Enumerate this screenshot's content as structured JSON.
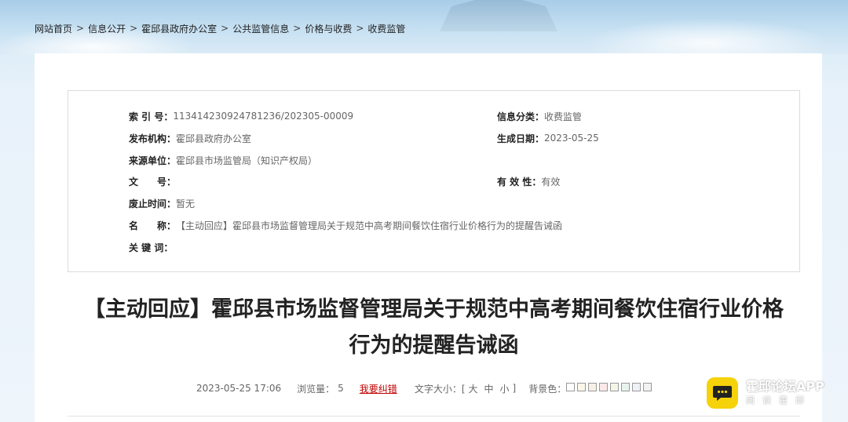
{
  "breadcrumb": {
    "items": [
      "网站首页",
      "信息公开",
      "霍邱县政府办公室",
      "公共监管信息",
      "价格与收费",
      "收费监管"
    ],
    "separator": ">"
  },
  "meta": {
    "index_label": "索 引 号：",
    "index_value": "113414230924781236/202305-00009",
    "category_label": "信息分类：",
    "category_value": "收费监管",
    "publisher_label": "发布机构：",
    "publisher_value": "霍邱县政府办公室",
    "date_label": "生成日期：",
    "date_value": "2023-05-25",
    "source_label": "来源单位：",
    "source_value": "霍邱县市场监管局（知识产权局）",
    "docno_label": "文　　号：",
    "docno_value": "",
    "validity_label": "有 效 性：",
    "validity_value": "有效",
    "abolish_label": "废止时间：",
    "abolish_value": "暂无",
    "name_label": "名　　称：",
    "name_value": "【主动回应】霍邱县市场监督管理局关于规范中高考期间餐饮住宿行业价格行为的提醒告诫函",
    "keywords_label": "关 键 词：",
    "keywords_value": ""
  },
  "article": {
    "title_line1": "【主动回应】霍邱县市场监督管理局关于规范中高考期间餐饮住宿行业价格",
    "title_line2": "行为的提醒告诫函",
    "datetime": "2023-05-25 17:06",
    "views_label": "浏览量：",
    "views_value": "5",
    "correct_link": "我要纠错",
    "font_size_label": "文字大小：[",
    "font_large": "大",
    "font_medium": "中",
    "font_small": "小",
    "font_size_close": "]",
    "bg_label": "背景色："
  },
  "bg_colors": [
    "#ffffff",
    "#faf6e8",
    "#f7f0e5",
    "#fbe8e8",
    "#f2f7e8",
    "#e6f4ec",
    "#eef1f5",
    "#f2f2f2"
  ],
  "app": {
    "name": "霍邱论坛APP",
    "sub": "阅读霍邱"
  },
  "icons": {
    "app_logo": "chat-bubble-icon"
  }
}
